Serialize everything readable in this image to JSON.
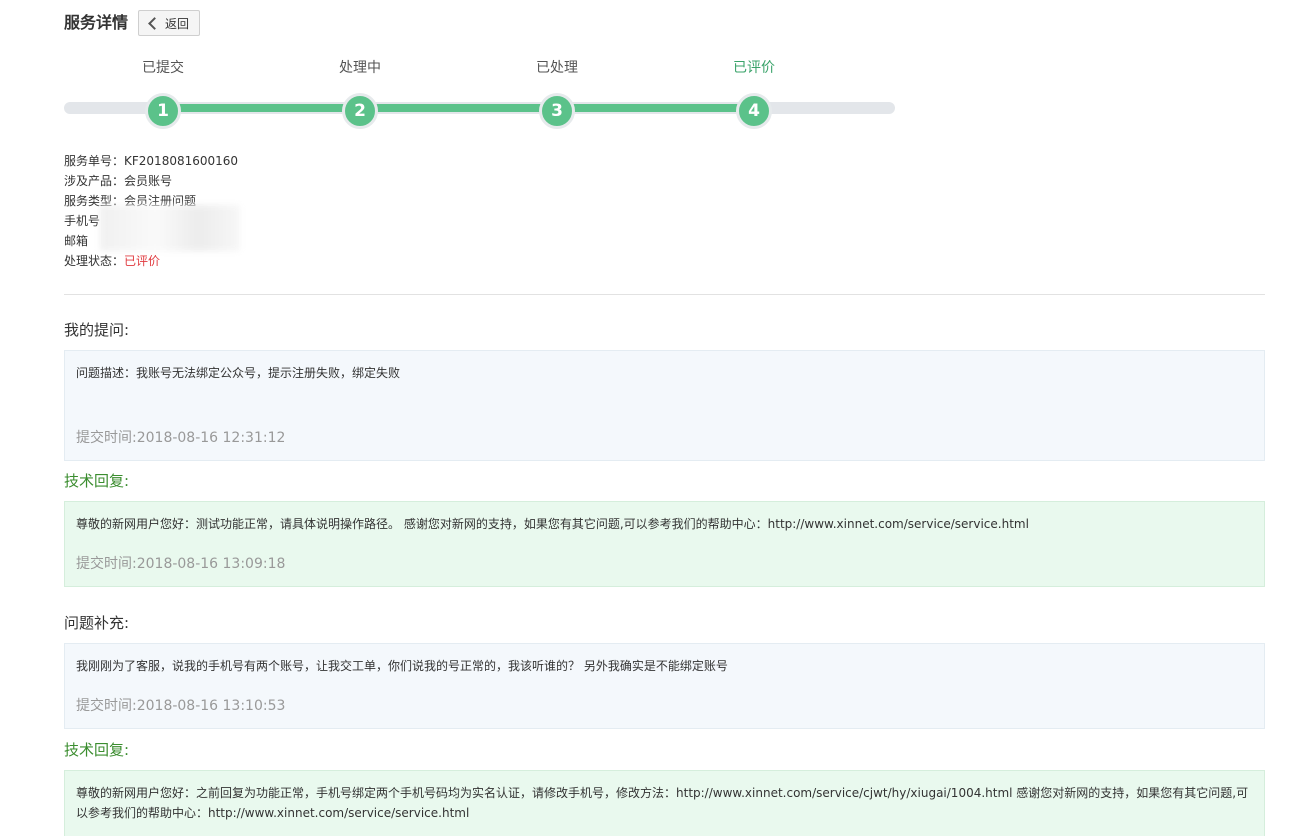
{
  "header": {
    "title": "服务详情",
    "back_label": "返回"
  },
  "stepper": {
    "steps": [
      {
        "label": "已提交",
        "number": "1"
      },
      {
        "label": "处理中",
        "number": "2"
      },
      {
        "label": "已处理",
        "number": "3"
      },
      {
        "label": "已评价",
        "number": "4"
      }
    ],
    "current_step": 4
  },
  "info": {
    "service_no_label": "服务单号：",
    "service_no": "KF2018081600160",
    "product_label": "涉及产品：",
    "product": "会员账号",
    "type_label": "服务类型：",
    "type": "会员注册问题",
    "phone_label": "手机号",
    "email_label": "邮箱",
    "status_label": "处理状态：",
    "status": "已评价"
  },
  "sections": {
    "question_title": "我的提问:",
    "question_text": "问题描述：我账号无法绑定公众号，提示注册失败，绑定失败",
    "question_time": "提交时间:2018-08-16 12:31:12",
    "reply1_title": "技术回复:",
    "reply1_text": "尊敬的新网用户您好：测试功能正常，请具体说明操作路径。 感谢您对新网的支持，如果您有其它问题,可以参考我们的帮助中心：http://www.xinnet.com/service/service.html",
    "reply1_time": "提交时间:2018-08-16 13:09:18",
    "supplement_title": "问题补充:",
    "supplement_text": "我刚刚为了客服，说我的手机号有两个账号，让我交工单，你们说我的号正常的，我该听谁的？ 另外我确实是不能绑定账号",
    "supplement_time": "提交时间:2018-08-16 13:10:53",
    "reply2_title": "技术回复:",
    "reply2_text": "尊敬的新网用户您好：之前回复为功能正常，手机号绑定两个手机号码均为实名认证，请修改手机号，修改方法：http://www.xinnet.com/service/cjwt/hy/xiugai/1004.html 感谢您对新网的支持，如果您有其它问题,可以参考我们的帮助中心：http://www.xinnet.com/service/service.html"
  },
  "colors": {
    "step_green": "#5bc28a",
    "status_red": "#e0393e",
    "reply_title_green": "#3b8d2f"
  }
}
